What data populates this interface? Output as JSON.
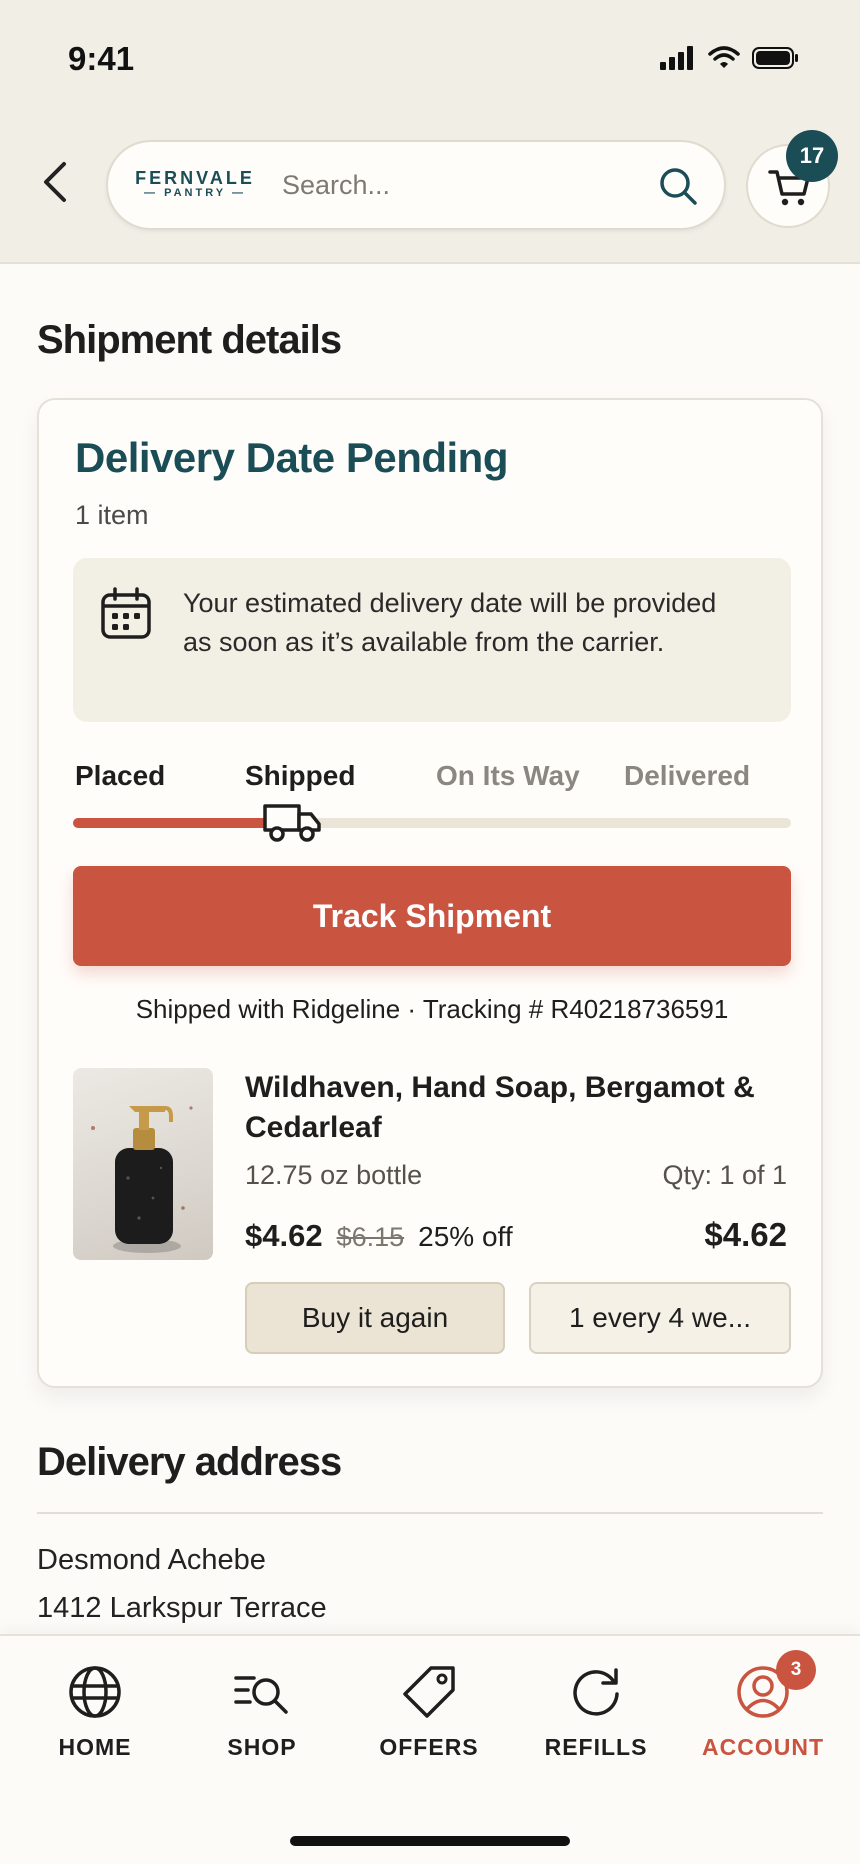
{
  "status_bar": {
    "time": "9:41"
  },
  "header": {
    "logo_top": "FERNVALE",
    "logo_bottom": "— PANTRY —",
    "search_placeholder": "Search...",
    "cart_count": "17"
  },
  "page_title": "Shipment details",
  "shipment": {
    "status_title": "Delivery Date Pending",
    "item_count": "1 item",
    "notice": "Your estimated delivery date will be provided as soon as it’s available from the carrier.",
    "steps": [
      "Placed",
      "Shipped",
      "On Its Way",
      "Delivered"
    ],
    "current_step": "Shipped",
    "progress_fraction": 0.28,
    "track_button": "Track Shipment",
    "ship_info": "Shipped with Ridgeline · Tracking # R40218736591"
  },
  "product": {
    "name": "Wildhaven, Hand Soap, Bergamot & Cedarleaf",
    "size": "12.75 oz bottle",
    "qty": "Qty: 1 of 1",
    "price": "$4.62",
    "old_price": "$6.15",
    "discount": "25% off",
    "total": "$4.62",
    "buy_again": "Buy it again",
    "subscription": "1 every 4 we..."
  },
  "address": {
    "title": "Delivery address",
    "name": "Desmond Achebe",
    "street": "1412 Larkspur Terrace"
  },
  "bottom_nav": {
    "items": [
      {
        "label": "HOME",
        "icon": "globe-icon"
      },
      {
        "label": "SHOP",
        "icon": "shop-search-icon"
      },
      {
        "label": "OFFERS",
        "icon": "tag-icon"
      },
      {
        "label": "REFILLS",
        "icon": "refresh-icon"
      },
      {
        "label": "ACCOUNT",
        "icon": "account-icon",
        "badge": "3",
        "active": true
      }
    ]
  },
  "colors": {
    "accent": "#c9543f",
    "brand_teal": "#1b4d57",
    "header_bg": "#f1eee6",
    "notice_bg": "#f2efe4"
  }
}
